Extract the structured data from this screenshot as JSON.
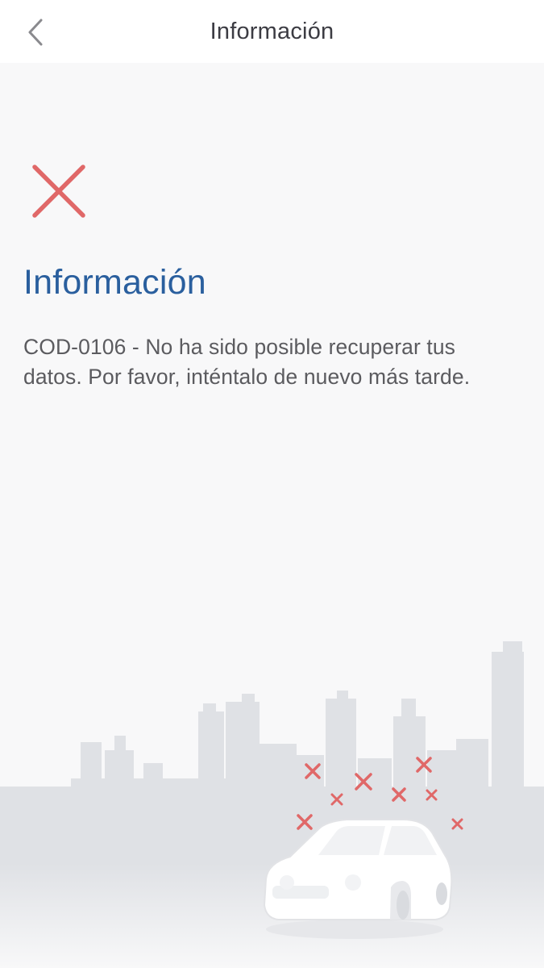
{
  "header": {
    "title": "Información",
    "back_icon": "chevron-left-icon"
  },
  "main": {
    "status_icon": "close-x-icon",
    "heading": "Información",
    "message": "COD-0106 - No ha sido posible recuperar tus datos. Por favor, inténtalo de nuevo más tarde."
  },
  "illustration": {
    "name": "city-skyline-broken-car"
  },
  "colors": {
    "navbar_bg": "#ffffff",
    "page_bg": "#f8f8f9",
    "heading": "#2a5f9e",
    "error_red": "#e06868",
    "text": "#5b5b5f",
    "skyline": "#dfe1e5"
  }
}
